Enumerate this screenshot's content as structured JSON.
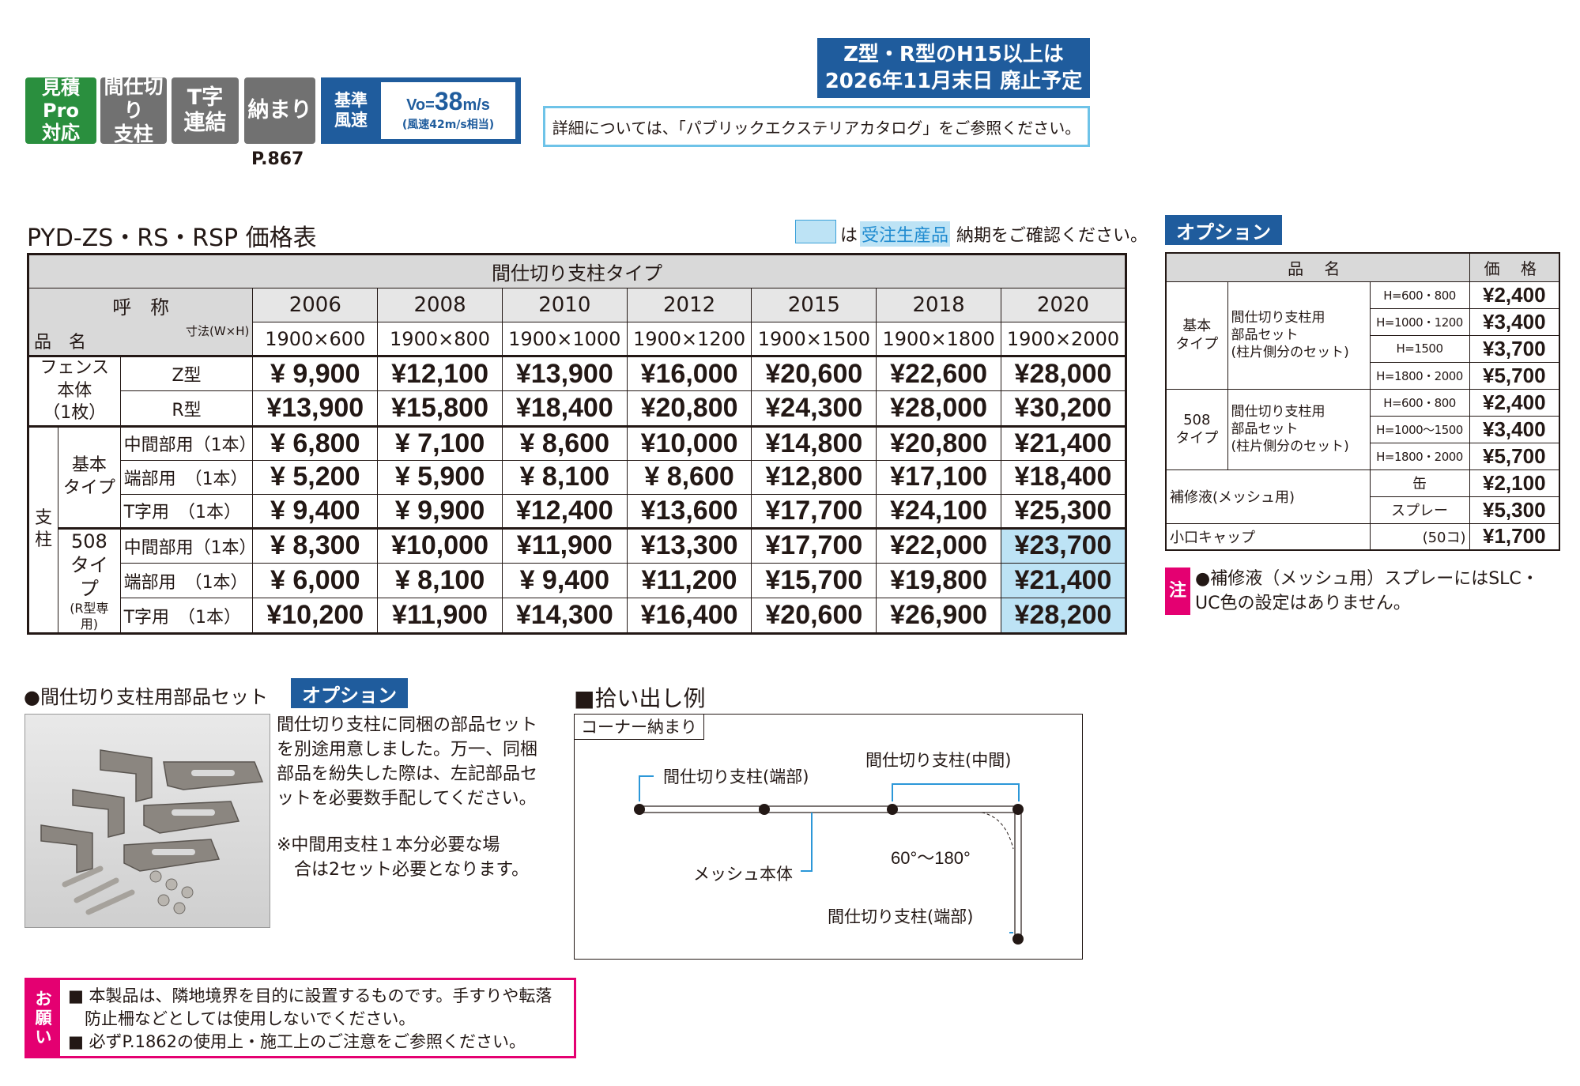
{
  "badges": {
    "mitsumori": "見積Pro\n対応",
    "majikiri": "間仕切り\n支柱",
    "tji": "T字\n連結",
    "osamari": "納まり",
    "page_ref": "P.867",
    "wind_label": "基準\n風速",
    "wind_value_prefix": "Vo=",
    "wind_value_num": "38",
    "wind_value_unit": "m/s",
    "wind_note": "(風速42m/s相当)"
  },
  "notice": {
    "line1": "Z型・R型のH15以上は",
    "line2": "2026年11月末日 廃止予定",
    "detail": "詳細については、「パブリックエクステリアカタログ」をご参照ください。"
  },
  "price_table": {
    "title": "PYD-ZS・RS・RSP 価格表",
    "legend_mid": "は",
    "legend_highlight": "受注生産品",
    "legend_tail": "納期をご確認ください。",
    "type_header": "間仕切り支柱タイプ",
    "label_yobi": "呼　称",
    "label_hinmei": "品　名",
    "label_sunpo": "寸法(W×H)",
    "codes": [
      "2006",
      "2008",
      "2010",
      "2012",
      "2015",
      "2018",
      "2020"
    ],
    "sizes": [
      "1900×600",
      "1900×800",
      "1900×1000",
      "1900×1200",
      "1900×1500",
      "1900×1800",
      "1900×2000"
    ],
    "fence_label": "フェンス本体\n（1枚）",
    "z_type": "Z型",
    "r_type": "R型",
    "z_prices": [
      "¥  9,900",
      "¥12,100",
      "¥13,900",
      "¥16,000",
      "¥20,600",
      "¥22,600",
      "¥28,000"
    ],
    "r_prices": [
      "¥13,900",
      "¥15,800",
      "¥18,400",
      "¥20,800",
      "¥24,300",
      "¥28,000",
      "¥30,200"
    ],
    "shichu": "支\n柱",
    "basic_type": "基本\nタイプ",
    "type508": "508\nタイプ",
    "type508_note": "(R型専用)",
    "row_chukan": "中間部用（1本）",
    "row_tanbu": "端部用　（1本）",
    "row_tji": "T字用　（1本）",
    "basic_chukan": [
      "¥  6,800",
      "¥  7,100",
      "¥  8,600",
      "¥10,000",
      "¥14,800",
      "¥20,800",
      "¥21,400"
    ],
    "basic_tanbu": [
      "¥  5,200",
      "¥  5,900",
      "¥  8,100",
      "¥  8,600",
      "¥12,800",
      "¥17,100",
      "¥18,400"
    ],
    "basic_tji": [
      "¥  9,400",
      "¥  9,900",
      "¥12,400",
      "¥13,600",
      "¥17,700",
      "¥24,100",
      "¥25,300"
    ],
    "t508_chukan": [
      "¥  8,300",
      "¥10,000",
      "¥11,900",
      "¥13,300",
      "¥17,700",
      "¥22,000",
      "¥23,700"
    ],
    "t508_tanbu": [
      "¥  6,000",
      "¥  8,100",
      "¥  9,400",
      "¥11,200",
      "¥15,700",
      "¥19,800",
      "¥21,400"
    ],
    "t508_tji": [
      "¥10,200",
      "¥11,900",
      "¥14,300",
      "¥16,400",
      "¥20,600",
      "¥26,900",
      "¥28,200"
    ]
  },
  "option_table": {
    "badge": "オプション",
    "hdr_name": "品 名",
    "hdr_price": "価 格",
    "basic_label": "基本\nタイプ",
    "t508_label": "508\nタイプ",
    "set_name": "間仕切り支柱用\n部品セット\n(柱片側分のセット)",
    "basic_heights": [
      "H=600・800",
      "H=1000・1200",
      "H=1500",
      "H=1800・2000"
    ],
    "basic_prices": [
      "¥2,400",
      "¥3,400",
      "¥3,700",
      "¥5,700"
    ],
    "t508_heights": [
      "H=600・800",
      "H=1000〜1500",
      "H=1800・2000"
    ],
    "t508_prices": [
      "¥2,400",
      "¥3,400",
      "¥5,700"
    ],
    "repair_label": "補修液(メッシュ用)",
    "repair_can": "缶",
    "repair_spray": "スプレー",
    "repair_can_price": "¥2,100",
    "repair_spray_price": "¥5,300",
    "cap_label": "小口キャップ",
    "cap_qty": "(50コ)",
    "cap_price": "¥1,700",
    "note_mark": "注",
    "note_text": "●補修液（メッシュ用）スプレーにはSLC・\nUC色の設定はありません。"
  },
  "parts": {
    "heading": "●間仕切り支柱用部品セット",
    "badge": "オプション",
    "desc": "間仕切り支柱に同梱の部品セットを別途用意しました。万一、同梱部品を紛失した際は、左記部品セットを必要数手配してください。",
    "note": "※中間用支柱１本分必要な場\n　合は2セット必要となります。"
  },
  "example": {
    "heading": "■拾い出し例",
    "box_label": "コーナー納まり",
    "label_tanbu1": "間仕切り支柱(端部)",
    "label_chukan": "間仕切り支柱(中間)",
    "label_mesh": "メッシュ本体",
    "label_angle": "60°〜180°",
    "label_tanbu2": "間仕切り支柱(端部)"
  },
  "request": {
    "mark": "お\n願\nい",
    "line1": "■ 本製品は、隣地境界を目的に設置するものです。手すりや転落",
    "line2": "　防止柵などとしては使用しないでください。",
    "line3": "■ 必ずP.1862の使用上・施工上のご注意をご参照ください。"
  }
}
